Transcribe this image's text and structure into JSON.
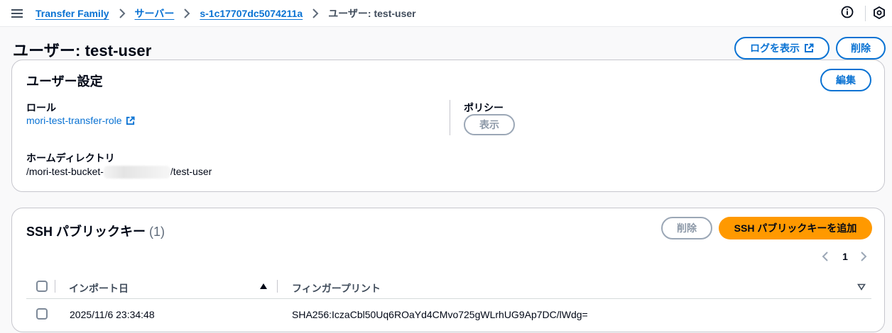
{
  "breadcrumb": {
    "items": [
      "Transfer Family",
      "サーバー",
      "s-1c17707dc5074211a"
    ],
    "current": "ユーザー: test-user"
  },
  "icons": {
    "menu": "menu-icon",
    "separator": "chevron-right-icon",
    "info": "info-icon",
    "settings": "settings-hexagon-icon",
    "external": "external-link-icon"
  },
  "page": {
    "title": "ユーザー: test-user",
    "logs_button": "ログを表示",
    "delete_button": "削除"
  },
  "user_settings": {
    "title": "ユーザー設定",
    "edit_button": "編集",
    "role_label": "ロール",
    "role_value": "mori-test-transfer-role",
    "policy_label": "ポリシー",
    "policy_button": "表示",
    "home_label": "ホームディレクトリ",
    "home_prefix": "/mori-test-bucket-",
    "home_suffix": "/test-user"
  },
  "ssh_keys": {
    "title": "SSH パブリックキー",
    "count": "(1)",
    "delete_button": "削除",
    "add_button": "SSH パブリックキーを追加",
    "pagination": {
      "current_page": "1"
    },
    "columns": [
      "インポート日",
      "フィンガープリント"
    ],
    "rows": [
      {
        "import_date": "2025/11/6 23:34:48",
        "fingerprint": "SHA256:IczaCbl50Uq6ROaYd4CMvo725gWLrhUG9Ap7DC/lWdg="
      }
    ]
  },
  "colors": {
    "link": "#0972d3",
    "primary_button": "#ff9900",
    "text": "#000716",
    "border": "#c6c6cd",
    "disabled": "#9ba7b6"
  }
}
